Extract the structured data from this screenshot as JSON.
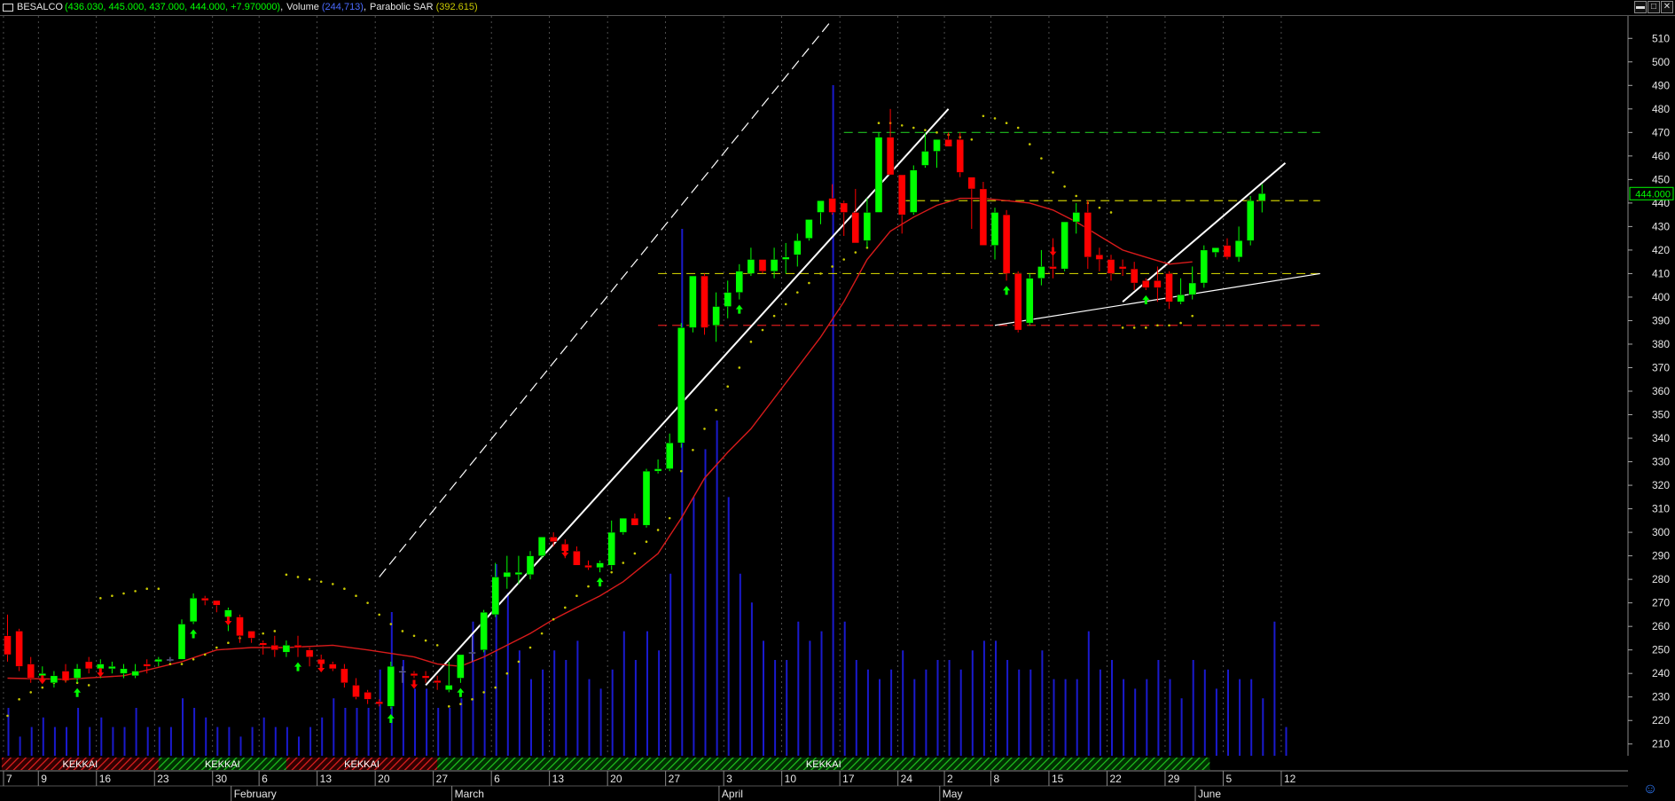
{
  "title_bar": {
    "symbol": "BESALCO",
    "ohlc": "(436.030, 445.000, 437.000, 444.000, +7.970000)",
    "sep1": ",",
    "volume_label": "Volume",
    "volume_value": "(244,713)",
    "sep2": ",",
    "sar_label": "Parabolic SAR",
    "sar_value": "(392.615)"
  },
  "window_buttons": [
    "▬",
    "□",
    "✕"
  ],
  "colors": {
    "background": "#000000",
    "bull": "#00ff00",
    "bear": "#ff0000",
    "neutral": "#8080c0",
    "ma": "#d81b1b",
    "sar": "#c8c800",
    "volume": "#1a1acd",
    "grid": "#6e6e6e",
    "axis_text": "#e6e6e6",
    "price_tag_fg": "#00ff00"
  },
  "chart_data": {
    "type": "candlestick",
    "symbol": "BESALCO",
    "ylim": [
      205,
      515
    ],
    "y_ticks": [
      210,
      220,
      230,
      240,
      250,
      260,
      270,
      280,
      290,
      300,
      310,
      320,
      330,
      340,
      350,
      360,
      370,
      380,
      390,
      400,
      410,
      420,
      430,
      440,
      450,
      460,
      470,
      480,
      490,
      500,
      510
    ],
    "last_price_label": "444.000",
    "x_ticks": [
      {
        "i": 0,
        "label": "7"
      },
      {
        "i": 3,
        "label": "9"
      },
      {
        "i": 8,
        "label": "16"
      },
      {
        "i": 13,
        "label": "23"
      },
      {
        "i": 18,
        "label": "30"
      },
      {
        "i": 22,
        "label": "6"
      },
      {
        "i": 27,
        "label": "13"
      },
      {
        "i": 32,
        "label": "20"
      },
      {
        "i": 37,
        "label": "27"
      },
      {
        "i": 42,
        "label": "6"
      },
      {
        "i": 47,
        "label": "13"
      },
      {
        "i": 52,
        "label": "20"
      },
      {
        "i": 57,
        "label": "27"
      },
      {
        "i": 62,
        "label": "3"
      },
      {
        "i": 67,
        "label": "10"
      },
      {
        "i": 72,
        "label": "17"
      },
      {
        "i": 77,
        "label": "24"
      },
      {
        "i": 81,
        "label": "2"
      },
      {
        "i": 85,
        "label": "8"
      },
      {
        "i": 90,
        "label": "15"
      },
      {
        "i": 95,
        "label": "22"
      },
      {
        "i": 100,
        "label": "29"
      },
      {
        "i": 105,
        "label": "5"
      },
      {
        "i": 110,
        "label": "12"
      }
    ],
    "months": [
      {
        "i": 19.6,
        "label": "February"
      },
      {
        "i": 38.6,
        "label": "March"
      },
      {
        "i": 61.6,
        "label": "April"
      },
      {
        "i": 80.6,
        "label": "May"
      },
      {
        "i": 102.6,
        "label": "June"
      }
    ],
    "candles": [
      [
        256,
        265,
        245,
        248
      ],
      [
        258,
        259,
        241,
        243
      ],
      [
        244,
        247,
        236,
        238
      ],
      [
        239,
        243,
        236,
        240
      ],
      [
        236,
        241,
        234,
        239
      ],
      [
        241,
        244,
        236,
        237
      ],
      [
        238,
        244,
        236,
        242
      ],
      [
        245,
        247,
        240,
        242
      ],
      [
        242,
        246,
        238,
        244
      ],
      [
        242,
        245,
        240,
        243
      ],
      [
        240,
        244,
        238,
        242
      ],
      [
        239,
        244,
        238,
        241
      ],
      [
        244,
        246,
        240,
        243
      ],
      [
        245,
        247,
        243,
        246
      ],
      [
        246,
        247,
        245,
        246
      ],
      [
        246,
        263,
        246,
        261
      ],
      [
        262,
        274,
        261,
        272
      ],
      [
        272,
        273,
        269,
        271
      ],
      [
        271,
        271,
        266,
        269
      ],
      [
        264,
        268,
        258,
        267
      ],
      [
        264,
        265,
        253,
        256
      ],
      [
        258,
        258,
        253,
        255
      ],
      [
        253,
        254,
        248,
        252
      ],
      [
        252,
        256,
        247,
        250
      ],
      [
        249,
        254,
        247,
        252
      ],
      [
        252,
        256,
        247,
        251
      ],
      [
        250,
        251,
        243,
        247
      ],
      [
        246,
        248,
        242,
        244
      ],
      [
        244,
        245,
        241,
        242
      ],
      [
        242,
        244,
        234,
        236
      ],
      [
        235,
        238,
        229,
        230
      ],
      [
        232,
        233,
        227,
        229
      ],
      [
        228,
        229,
        226,
        227
      ],
      [
        226,
        245,
        225,
        243
      ],
      [
        241,
        243,
        236,
        241
      ],
      [
        240,
        241,
        238,
        239
      ],
      [
        239,
        241,
        236,
        238
      ],
      [
        237,
        239,
        233,
        236
      ],
      [
        233,
        245,
        232,
        235
      ],
      [
        238,
        247,
        236,
        248
      ],
      [
        249,
        256,
        245,
        249
      ],
      [
        250,
        267,
        249,
        266
      ],
      [
        265,
        287,
        264,
        281
      ],
      [
        281,
        290,
        276,
        283
      ],
      [
        282,
        290,
        278,
        283
      ],
      [
        282,
        292,
        280,
        290
      ],
      [
        290,
        298,
        289,
        298
      ],
      [
        298,
        300,
        294,
        296
      ],
      [
        295,
        297,
        289,
        292
      ],
      [
        292,
        294,
        287,
        286
      ],
      [
        286,
        288,
        284,
        285
      ],
      [
        285,
        288,
        283,
        287
      ],
      [
        286,
        305,
        284,
        300
      ],
      [
        300,
        306,
        299,
        306
      ],
      [
        306,
        308,
        303,
        303
      ],
      [
        303,
        327,
        302,
        326
      ],
      [
        326,
        331,
        325,
        327
      ],
      [
        327,
        342,
        326,
        338
      ],
      [
        338,
        389,
        336,
        387
      ],
      [
        387,
        409,
        385,
        409
      ],
      [
        409,
        410,
        384,
        387
      ],
      [
        388,
        402,
        381,
        396
      ],
      [
        396,
        407,
        391,
        402
      ],
      [
        402,
        414,
        399,
        411
      ],
      [
        410,
        421,
        409,
        416
      ],
      [
        416,
        416,
        410,
        411
      ],
      [
        411,
        421,
        408,
        416
      ],
      [
        416,
        423,
        410,
        417
      ],
      [
        418,
        427,
        413,
        424
      ],
      [
        425,
        431,
        424,
        433
      ],
      [
        436,
        439,
        431,
        441
      ],
      [
        442,
        448,
        435,
        436
      ],
      [
        440,
        441,
        426,
        436
      ],
      [
        436,
        446,
        425,
        423
      ],
      [
        424,
        442,
        421,
        436
      ],
      [
        436,
        470,
        436,
        468
      ],
      [
        468,
        480,
        455,
        452
      ],
      [
        452,
        445,
        427,
        435
      ],
      [
        436,
        456,
        435,
        454
      ],
      [
        456,
        470,
        455,
        462
      ],
      [
        462,
        467,
        455,
        467
      ],
      [
        467,
        470,
        466,
        464
      ],
      [
        467,
        470,
        451,
        453
      ],
      [
        451,
        449,
        429,
        446
      ],
      [
        446,
        449,
        436,
        422
      ],
      [
        422,
        438,
        416,
        436
      ],
      [
        435,
        437,
        407,
        410
      ],
      [
        410,
        411,
        385,
        386
      ],
      [
        389,
        410,
        388,
        408
      ],
      [
        408,
        420,
        405,
        413
      ],
      [
        413,
        425,
        408,
        412
      ],
      [
        412,
        432,
        411,
        432
      ],
      [
        432,
        440,
        427,
        436
      ],
      [
        436,
        441,
        412,
        417
      ],
      [
        418,
        421,
        411,
        416
      ],
      [
        416,
        418,
        407,
        410
      ],
      [
        413,
        416,
        409,
        412
      ],
      [
        412,
        415,
        403,
        406
      ],
      [
        407,
        408,
        403,
        404
      ],
      [
        407,
        413,
        398,
        404
      ],
      [
        410,
        411,
        395,
        398
      ],
      [
        398,
        408,
        397,
        401
      ],
      [
        401,
        413,
        399,
        406
      ],
      [
        406,
        422,
        404,
        420
      ],
      [
        419,
        420,
        417,
        421
      ],
      [
        422,
        425,
        416,
        417
      ],
      [
        417,
        430,
        415,
        424
      ],
      [
        424,
        443,
        422,
        441
      ],
      [
        441,
        448,
        436,
        444
      ]
    ],
    "volume": [
      0.5,
      0.2,
      0.3,
      0.4,
      0.3,
      0.3,
      0.5,
      0.3,
      0.4,
      0.3,
      0.3,
      0.5,
      0.3,
      0.3,
      0.3,
      0.6,
      0.5,
      0.4,
      0.3,
      0.3,
      0.2,
      0.3,
      0.4,
      0.3,
      0.3,
      0.2,
      0.3,
      0.4,
      0.6,
      0.5,
      0.5,
      0.5,
      0.9,
      1.5,
      1.0,
      0.7,
      0.7,
      0.5,
      0.5,
      0.6,
      1.4,
      1.5,
      2.0,
      1.7,
      1.1,
      0.8,
      0.9,
      1.1,
      1.0,
      1.2,
      0.8,
      0.7,
      0.9,
      1.3,
      1.0,
      1.3,
      1.1,
      1.9,
      5.5,
      2.7,
      3.2,
      3.5,
      2.7,
      1.9,
      1.6,
      1.2,
      1.0,
      1.0,
      1.4,
      1.2,
      1.3,
      7.0,
      1.4,
      1.0,
      0.9,
      0.8,
      0.9,
      1.1,
      0.8,
      0.9,
      1.0,
      1.0,
      0.9,
      1.1,
      1.2,
      1.2,
      1.0,
      0.9,
      0.9,
      1.1,
      0.8,
      0.8,
      0.8,
      1.3,
      0.9,
      1.0,
      0.8,
      0.7,
      0.8,
      1.0,
      0.8,
      0.6,
      1.0,
      0.9,
      0.7,
      0.9,
      0.8,
      0.8,
      0.6,
      1.4,
      0.3
    ],
    "ma": [
      [
        0,
        238
      ],
      [
        5,
        237.5
      ],
      [
        10,
        239
      ],
      [
        15,
        245
      ],
      [
        18,
        250
      ],
      [
        21,
        251
      ],
      [
        24,
        251
      ],
      [
        28,
        252
      ],
      [
        31,
        250
      ],
      [
        35,
        247
      ],
      [
        37,
        244
      ],
      [
        39,
        243
      ],
      [
        41,
        247
      ],
      [
        43,
        252
      ],
      [
        45,
        257
      ],
      [
        47,
        263
      ],
      [
        49,
        268
      ],
      [
        51,
        273
      ],
      [
        53,
        279
      ],
      [
        56,
        291
      ],
      [
        58,
        306
      ],
      [
        60,
        323
      ],
      [
        62,
        334
      ],
      [
        64,
        344
      ],
      [
        66,
        357
      ],
      [
        68,
        370
      ],
      [
        70,
        383
      ],
      [
        72,
        398
      ],
      [
        74,
        416
      ],
      [
        76,
        428
      ],
      [
        78,
        434
      ],
      [
        80,
        439
      ],
      [
        82,
        442
      ],
      [
        84,
        442
      ],
      [
        86,
        441
      ],
      [
        88,
        440
      ],
      [
        90,
        437
      ],
      [
        92,
        432
      ],
      [
        94,
        426
      ],
      [
        96,
        420
      ],
      [
        98,
        417
      ],
      [
        100,
        414
      ],
      [
        102,
        415
      ]
    ],
    "sar": [
      [
        0,
        222
      ],
      [
        1,
        229
      ],
      [
        2,
        232
      ],
      [
        3,
        234
      ],
      [
        4,
        236
      ],
      [
        5,
        237
      ],
      [
        6,
        236
      ],
      [
        7,
        235
      ],
      [
        8,
        272
      ],
      [
        9,
        273
      ],
      [
        10,
        274
      ],
      [
        11,
        275
      ],
      [
        12,
        276
      ],
      [
        13,
        276
      ],
      [
        14,
        244
      ],
      [
        15,
        244
      ],
      [
        16,
        246
      ],
      [
        17,
        248
      ],
      [
        18,
        251
      ],
      [
        19,
        253
      ],
      [
        20,
        255
      ],
      [
        21,
        256
      ],
      [
        22,
        257
      ],
      [
        23,
        258
      ],
      [
        24,
        282
      ],
      [
        25,
        281
      ],
      [
        26,
        280
      ],
      [
        27,
        279
      ],
      [
        28,
        278
      ],
      [
        29,
        276
      ],
      [
        30,
        273
      ],
      [
        31,
        270
      ],
      [
        32,
        265
      ],
      [
        33,
        261
      ],
      [
        34,
        258
      ],
      [
        35,
        256
      ],
      [
        36,
        254
      ],
      [
        37,
        252
      ],
      [
        38,
        226
      ],
      [
        39,
        227
      ],
      [
        40,
        229
      ],
      [
        41,
        232
      ],
      [
        42,
        234
      ],
      [
        43,
        240
      ],
      [
        44,
        245
      ],
      [
        45,
        251
      ],
      [
        46,
        257
      ],
      [
        47,
        263
      ],
      [
        48,
        268
      ],
      [
        49,
        273
      ],
      [
        50,
        277
      ],
      [
        51,
        280
      ],
      [
        52,
        283
      ],
      [
        53,
        287
      ],
      [
        54,
        291
      ],
      [
        55,
        296
      ],
      [
        56,
        301
      ],
      [
        57,
        306
      ],
      [
        58,
        326
      ],
      [
        59,
        335
      ],
      [
        60,
        344
      ],
      [
        61,
        352
      ],
      [
        62,
        362
      ],
      [
        63,
        370
      ],
      [
        64,
        381
      ],
      [
        65,
        386
      ],
      [
        66,
        392
      ],
      [
        67,
        397
      ],
      [
        68,
        402
      ],
      [
        69,
        406
      ],
      [
        70,
        410
      ],
      [
        71,
        413
      ],
      [
        72,
        416
      ],
      [
        73,
        419
      ],
      [
        74,
        421
      ],
      [
        75,
        474
      ],
      [
        76,
        474
      ],
      [
        77,
        473
      ],
      [
        78,
        472
      ],
      [
        79,
        471
      ],
      [
        80,
        470
      ],
      [
        81,
        469
      ],
      [
        82,
        468
      ],
      [
        83,
        467
      ],
      [
        84,
        477
      ],
      [
        85,
        476
      ],
      [
        86,
        474
      ],
      [
        87,
        472
      ],
      [
        88,
        465
      ],
      [
        89,
        459
      ],
      [
        90,
        453
      ],
      [
        91,
        447
      ],
      [
        92,
        443
      ],
      [
        93,
        440
      ],
      [
        94,
        438
      ],
      [
        95,
        436
      ],
      [
        96,
        387
      ],
      [
        97,
        387
      ],
      [
        98,
        387
      ],
      [
        99,
        388
      ],
      [
        100,
        388
      ],
      [
        101,
        389
      ],
      [
        102,
        392
      ]
    ],
    "signals": [
      {
        "i": 3,
        "dir": "down"
      },
      {
        "i": 6,
        "dir": "up"
      },
      {
        "i": 8,
        "dir": "down"
      },
      {
        "i": 16,
        "dir": "up"
      },
      {
        "i": 19,
        "dir": "down"
      },
      {
        "i": 25,
        "dir": "up"
      },
      {
        "i": 27,
        "dir": "down"
      },
      {
        "i": 33,
        "dir": "up"
      },
      {
        "i": 35,
        "dir": "down"
      },
      {
        "i": 39,
        "dir": "up"
      },
      {
        "i": 48,
        "dir": "down"
      },
      {
        "i": 51,
        "dir": "up"
      },
      {
        "i": 60,
        "dir": "down"
      },
      {
        "i": 63,
        "dir": "up"
      },
      {
        "i": 82,
        "dir": "down"
      },
      {
        "i": 86,
        "dir": "up"
      },
      {
        "i": 90,
        "dir": "down"
      },
      {
        "i": 98,
        "dir": "up"
      }
    ],
    "hlines": [
      {
        "y": 470,
        "color": "#1fbf1f",
        "from": 72,
        "to": 113
      },
      {
        "y": 441,
        "color": "#c8c800",
        "from": 77,
        "to": 113
      },
      {
        "y": 410,
        "color": "#c8c800",
        "from": 56,
        "to": 113
      },
      {
        "y": 388,
        "color": "#d81b1b",
        "from": 56,
        "to": 113
      }
    ],
    "trendlines": [
      {
        "x1": 36,
        "y1": 235,
        "x2": 81,
        "y2": 480,
        "width": 2,
        "dash": ""
      },
      {
        "x1": 32,
        "y1": 281,
        "x2": 71,
        "y2": 518,
        "width": 1.2,
        "dash": "12,6"
      },
      {
        "x1": 85,
        "y1": 388,
        "x2": 113,
        "y2": 410,
        "width": 1.2,
        "dash": ""
      },
      {
        "x1": 96,
        "y1": 398,
        "x2": 110,
        "y2": 457,
        "width": 2,
        "dash": ""
      }
    ],
    "bands": [
      {
        "from": 0,
        "to": 13.5,
        "label": "KEKKAI",
        "type": "bear"
      },
      {
        "from": 13.5,
        "to": 24.5,
        "label": "KEKKAI",
        "type": "bull"
      },
      {
        "from": 24.5,
        "to": 37.5,
        "label": "KEKKAI",
        "type": "bear"
      },
      {
        "from": 37.5,
        "to": 104,
        "label": "KEKKAI",
        "type": "bull"
      }
    ]
  }
}
